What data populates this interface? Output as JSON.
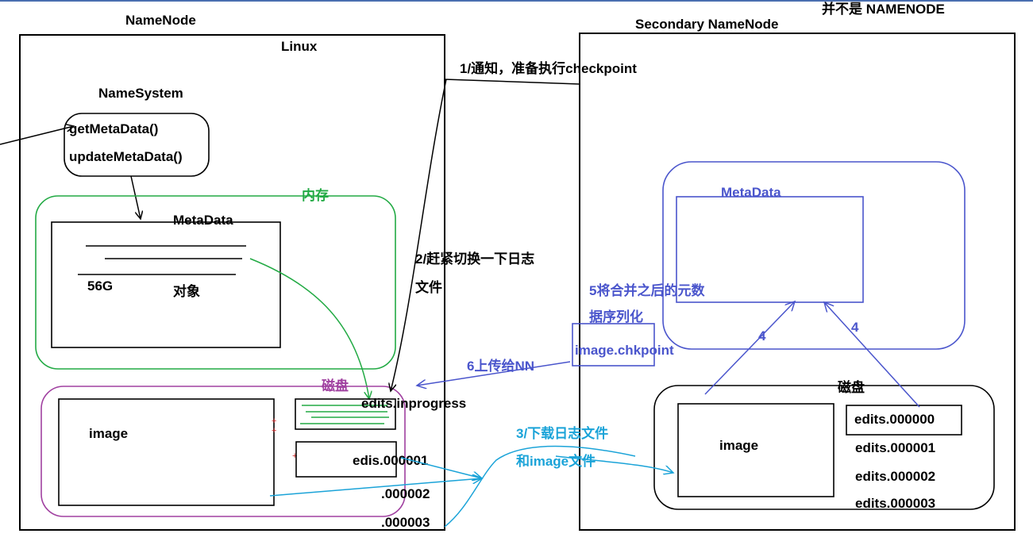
{
  "colors": {
    "black": "#000000",
    "green": "#22aa44",
    "purple": "#a040a0",
    "blue": "#4a55cc",
    "cyan": "#1aa3d8",
    "red": "#cc2222"
  },
  "namenode": {
    "title": "NameNode",
    "linux_label": "Linux",
    "namesystem_label": "NameSystem",
    "methods": [
      "getMetaData()",
      "updateMetaData()"
    ],
    "memory_label": "内存",
    "metadata_label": "MetaData",
    "metadata_size": "56G",
    "metadata_object": "对象",
    "disk_label": "磁盘",
    "image_label": "image",
    "edits_inprogress": "edits.inprogress",
    "edits_files": [
      "edis.000001",
      ".000002",
      ".000003"
    ]
  },
  "secondary": {
    "title": "Secondary NameNode",
    "note": "并不是 NAMENODE",
    "metadata_label": "MetaData",
    "disk_label": "磁盘",
    "image_label": "image",
    "edits_files": [
      "edits.000000",
      "edits.000001",
      "edits.000002",
      "edits.000003"
    ],
    "chkpoint_label": "image.chkpoint"
  },
  "steps": {
    "step1": "1/通知，准备执行checkpoint",
    "step2_line1": "2/赶紧切换一下日志",
    "step2_line2": "文件",
    "step3_line1": "3/下载日志文件",
    "step3_line2": "和image文件",
    "step4": "4",
    "step5_line1": "5将合并之后的元数",
    "step5_line2": "据序列化",
    "step6": "6上传给NN"
  }
}
